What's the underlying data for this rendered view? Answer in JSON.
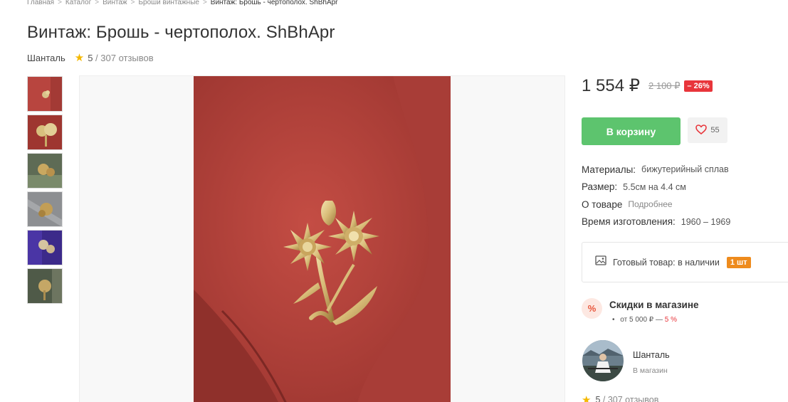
{
  "breadcrumb": {
    "items": [
      "Главная",
      "Каталог",
      "Винтаж",
      "Броши винтажные"
    ],
    "current": "Винтаж: Брошь - чертополох. ShBhApr",
    "separator": ">"
  },
  "product": {
    "title": "Винтаж: Брошь - чертополох. ShBhApr",
    "shop": "Шанталь",
    "rating": "5",
    "reviews": "/ 307 отзывов"
  },
  "pricing": {
    "price": "1 554 ₽",
    "old_price": "2 100 ₽",
    "discount": "– 26%"
  },
  "actions": {
    "cart_label": "В корзину",
    "favorites_count": "55"
  },
  "properties": {
    "materials_label": "Материалы:",
    "materials_value": "бижутерийный сплав",
    "size_label": "Размер:",
    "size_value": "5.5см на 4.4 см",
    "about_label": "О товаре",
    "about_link": "Подробнее",
    "made_label": "Время изготовления:",
    "made_value": "1960 – 1969"
  },
  "stock": {
    "text": "Готовый товар: в наличии",
    "badge": "1 шт"
  },
  "discounts": {
    "icon": "%",
    "title": "Скидки в магазине",
    "item_from": "от 5 000 ₽ —",
    "item_pct": "5 %"
  },
  "seller": {
    "name": "Шанталь",
    "link": "В магазин",
    "rating": "5",
    "reviews": "/ 307 отзывов"
  },
  "colors": {
    "accent_green": "#5dc46e",
    "discount_red": "#e8353b",
    "stock_orange": "#ee8b1d",
    "star": "#f5b800"
  }
}
